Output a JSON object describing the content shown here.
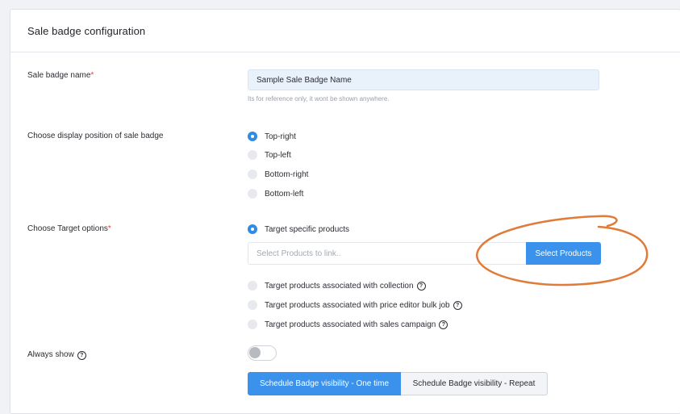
{
  "card": {
    "title": "Sale badge configuration"
  },
  "badge_name": {
    "label": "Sale badge name",
    "required_mark": "*",
    "value": "Sample Sale Badge Name",
    "hint": "Its for reference only, it wont be shown anywhere."
  },
  "position": {
    "label": "Choose display position of sale badge",
    "options": [
      "Top-right",
      "Top-left",
      "Bottom-right",
      "Bottom-left"
    ],
    "selected": "Top-right"
  },
  "target": {
    "label": "Choose Target options",
    "required_mark": "*",
    "options": [
      "Target specific products",
      "Target products associated with collection",
      "Target products associated with price editor bulk job",
      "Target products associated with sales campaign"
    ],
    "selected": "Target specific products",
    "product_placeholder": "Select Products to link..",
    "select_button": "Select Products",
    "help_icon": "?"
  },
  "always_show": {
    "label": "Always show",
    "help_icon": "?",
    "enabled": false
  },
  "schedule": {
    "one_time": "Schedule Badge visibility - One time",
    "repeat": "Schedule Badge visibility - Repeat",
    "active": "one_time"
  },
  "colors": {
    "accent": "#3b92ec",
    "annotation": "#e07b39",
    "required": "#e2423d"
  }
}
